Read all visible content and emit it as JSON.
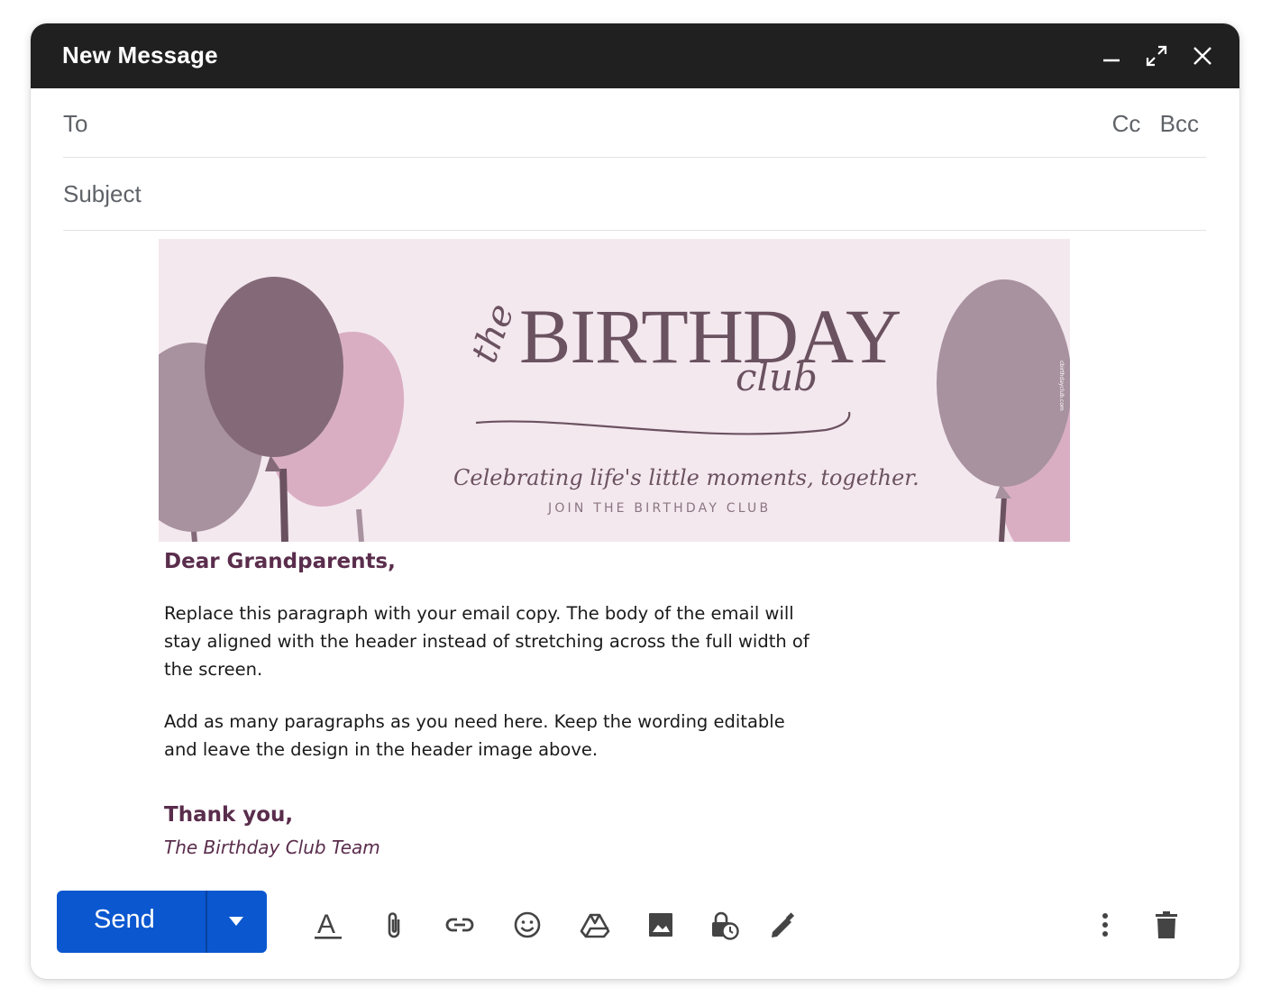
{
  "window": {
    "title": "New Message",
    "controls": [
      "minimize-icon",
      "expand-icon",
      "close-icon"
    ]
  },
  "fields": {
    "to_label": "To",
    "cc_label": "Cc",
    "bcc_label": "Bcc",
    "subject_label": "Subject"
  },
  "banner": {
    "logo_prefix": "the",
    "logo_main": "BIRTHDAY",
    "logo_suffix": "club",
    "tagline": "Celebrating life's little moments, together.",
    "cta": "JOIN THE BIRTHDAY CLUB",
    "side_text": "cbirthdayclub.com",
    "colors": {
      "background": "#f4e8ef",
      "balloon_dark": "#846a78",
      "balloon_mid": "#a8929f",
      "balloon_pink": "#d9aec3",
      "logo_text": "#6b5260"
    }
  },
  "body": {
    "greeting": "Dear Grandparents,",
    "paragraph1": "Replace this paragraph with your email copy. The body of the email will stay aligned with the header instead of stretching across the full width of the screen.",
    "paragraph2": "Add as many paragraphs as you need here. Keep the wording editable and leave the design in the header image above.",
    "closing": "Thank you,",
    "signature": "The Birthday Club Team"
  },
  "toolbar": {
    "send_label": "Send",
    "send_color": "#0b57d0",
    "tools": [
      "formatting-icon",
      "attach-icon",
      "link-icon",
      "emoji-icon",
      "drive-icon",
      "photo-icon",
      "confidential-icon",
      "signature-icon",
      "more-options-icon",
      "discard-icon"
    ]
  }
}
